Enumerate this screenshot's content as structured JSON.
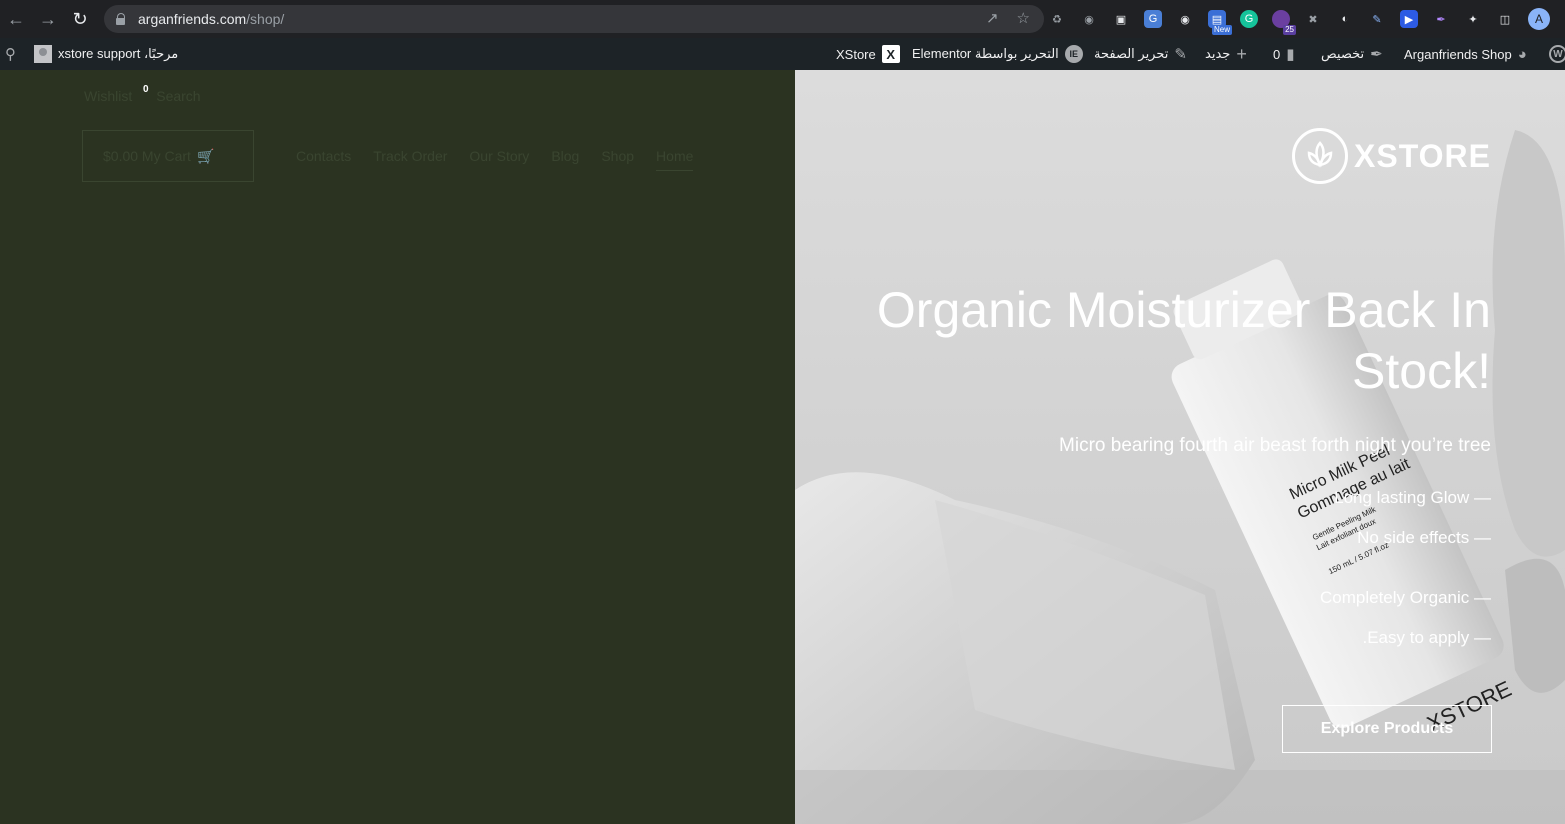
{
  "browser": {
    "url_host": "arganfriends.com",
    "url_path": "/shop/",
    "profile_initial": "A",
    "ext_new_badge": "New",
    "ext_count_badge": "25"
  },
  "admin_bar": {
    "greeting": "مرحبًا، xstore support",
    "xstore": "XStore",
    "elementor": "التحرير بواسطة Elementor",
    "edit_page": "تحرير الصفحة",
    "new": "جديد",
    "comments": "0",
    "customize": "تخصيص",
    "site_name": "Arganfriends Shop"
  },
  "header": {
    "wishlist": "Wishlist",
    "wishlist_count": "0",
    "search": "Search",
    "cart": "$0.00 My Cart",
    "menu": [
      "Contacts",
      "Track Order",
      "Our Story",
      "Blog",
      "Shop",
      "Home"
    ]
  },
  "hero": {
    "logo": "XSTORE",
    "headline": "Organic Moisturizer Back In Stock!",
    "subtitle": "Micro bearing fourth air beast forth night you’re tree",
    "bullets": [
      "Long lasting Glow —",
      "No side effects —",
      "Completely Organic —",
      ".Easy to apply —"
    ],
    "cta": "Explore Products",
    "bottle_line1": "Micro Milk Peel",
    "bottle_line2": "Gommage au lait",
    "bottle_line3": "Gentle Peeling Milk",
    "bottle_line4": "Lait exfoliant doux",
    "bottle_line5": "150 mL / 5.07 fl.oz",
    "bottle_brand": "XSTORE"
  }
}
